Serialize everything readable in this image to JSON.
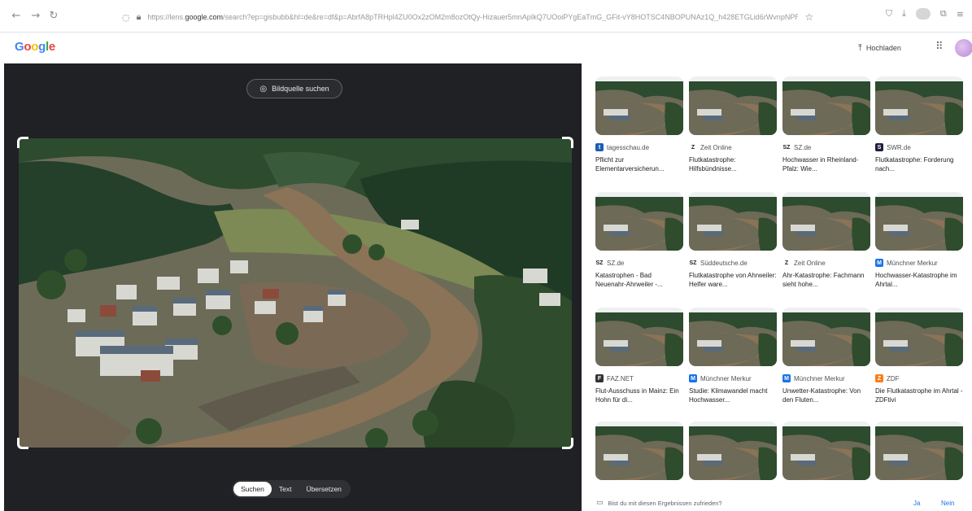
{
  "browser": {
    "url_prefix": "https://lens.",
    "url_domain": "google.com",
    "url_rest": "/search?ep=gisbubb&hl=de&re=df&p=AbrfA8pTRHpl4ZU0Ox2zOM2m8ozOtQy-Hizauer5mnApIkQ7UOoiPYgEaTmG_GFit-vY8HOTSC4NBOPUNAz1Q_h428ETGLid6rWvnpNPRpljdtOHJ"
  },
  "header": {
    "logo": "Google",
    "upload_label": "Hochladen"
  },
  "lens": {
    "source_button": "Bildquelle suchen",
    "modes": [
      "Suchen",
      "Text",
      "Übersetzen"
    ],
    "active_mode": "Suchen"
  },
  "results": [
    {
      "source": "tagesschau.de",
      "title": "Pflicht zur Elementarversicherun...",
      "fav_color": "#1a5fb4",
      "fav_letter": "t"
    },
    {
      "source": "Zeit Online",
      "title": "Flutkatastrophe: Hilfsbündnisse...",
      "fav_color": "#ffffff",
      "fav_letter": "Z"
    },
    {
      "source": "SZ.de",
      "title": "Hochwasser in Rheinland-Pfalz: Wie...",
      "fav_color": "#ffffff",
      "fav_letter": "SZ"
    },
    {
      "source": "SWR.de",
      "title": "Flutkatastrophe: Forderung nach...",
      "fav_color": "#1e1f3d",
      "fav_letter": "S"
    },
    {
      "source": "SZ.de",
      "title": "Katastrophen - Bad Neuenahr-Ahrweiler -...",
      "fav_color": "#ffffff",
      "fav_letter": "SZ"
    },
    {
      "source": "Süddeutsche.de",
      "title": "Flutkatastrophe von Ahrweiler: Helfer ware...",
      "fav_color": "#ffffff",
      "fav_letter": "SZ"
    },
    {
      "source": "Zeit Online",
      "title": "Ahr-Katastrophe: Fachmann sieht hohe...",
      "fav_color": "#ffffff",
      "fav_letter": "Z"
    },
    {
      "source": "Münchner Merkur",
      "title": "Hochwasser-Katastrophe im Ahrtal...",
      "fav_color": "#1a73e8",
      "fav_letter": "M"
    },
    {
      "source": "FAZ.NET",
      "title": "Flut-Ausschuss in Mainz: Ein Hohn für di...",
      "fav_color": "#333333",
      "fav_letter": "F"
    },
    {
      "source": "Münchner Merkur",
      "title": "Studie: Klimawandel macht Hochwasser...",
      "fav_color": "#1a73e8",
      "fav_letter": "M"
    },
    {
      "source": "Münchner Merkur",
      "title": "Unwetter-Katastrophe: Von den Fluten...",
      "fav_color": "#1a73e8",
      "fav_letter": "M"
    },
    {
      "source": "ZDF",
      "title": "Die Flutkatastrophe im Ahrtal - ZDFtivi",
      "fav_color": "#fa7d19",
      "fav_letter": "Z"
    },
    {
      "source": "",
      "title": "",
      "fav_color": "",
      "fav_letter": ""
    },
    {
      "source": "",
      "title": "",
      "fav_color": "",
      "fav_letter": ""
    },
    {
      "source": "",
      "title": "",
      "fav_color": "",
      "fav_letter": ""
    },
    {
      "source": "",
      "title": "",
      "fav_color": "",
      "fav_letter": ""
    }
  ],
  "feedback": {
    "question": "Bist du mit diesen Ergebnissen zufrieden?",
    "yes": "Ja",
    "no": "Nein"
  }
}
